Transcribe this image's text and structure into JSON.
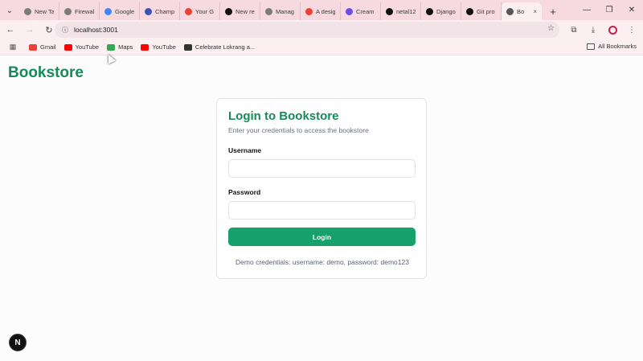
{
  "browser": {
    "tabs": [
      {
        "title": "New Ta",
        "icon_color": "#7b7b7b",
        "icon": "globe-icon"
      },
      {
        "title": "Firewall",
        "icon_color": "#7b7b7b",
        "icon": "globe-icon"
      },
      {
        "title": "Google",
        "icon_color": "#4285f4",
        "icon": "google-icon"
      },
      {
        "title": "Champ",
        "icon_color": "#3f51b5",
        "icon": "calendar-icon"
      },
      {
        "title": "Your G",
        "icon_color": "#ea4335",
        "icon": "gmail-icon"
      },
      {
        "title": "New re",
        "icon_color": "#111111",
        "icon": "github-icon"
      },
      {
        "title": "Manag",
        "icon_color": "#7b7b7b",
        "icon": "globe-icon"
      },
      {
        "title": "A desig",
        "icon_color": "#ea4335",
        "icon": "gmail-icon"
      },
      {
        "title": "Cream",
        "icon_color": "#6b4de6",
        "icon": "app-icon"
      },
      {
        "title": "netal12",
        "icon_color": "#111111",
        "icon": "github-icon"
      },
      {
        "title": "Django",
        "icon_color": "#111111",
        "icon": "django-icon"
      },
      {
        "title": "Git pro",
        "icon_color": "#111111",
        "icon": "openai-icon"
      },
      {
        "title": "Bo",
        "icon_color": "#555555",
        "icon": "globe-icon",
        "active": true
      }
    ],
    "tab_close": "×",
    "new_tab": "+",
    "url": "localhost:3001",
    "bookmarks": [
      {
        "label": "Gmail",
        "icon": "gmail-icon",
        "color": "#ea4335"
      },
      {
        "label": "YouTube",
        "icon": "youtube-icon",
        "color": "#ff0000"
      },
      {
        "label": "Maps",
        "icon": "maps-icon",
        "color": "#34a853"
      },
      {
        "label": "YouTube",
        "icon": "youtube-icon",
        "color": "#ff0000"
      },
      {
        "label": "Celebrate Lokrang a...",
        "icon": "globe-icon",
        "color": "#333333"
      }
    ],
    "all_bookmarks": "All Bookmarks"
  },
  "page": {
    "brand": "Bookstore",
    "card": {
      "title": "Login to Bookstore",
      "subtitle": "Enter your credentials to access the bookstore",
      "username_label": "Username",
      "password_label": "Password",
      "username_value": "",
      "password_value": "",
      "login_button": "Login",
      "demo_text": "Demo credentials: username: demo, password: demo123"
    },
    "dev_badge": "N"
  },
  "colors": {
    "brand": "#178a58",
    "button": "#16a06a",
    "tabstrip": "#f7d9e0"
  }
}
